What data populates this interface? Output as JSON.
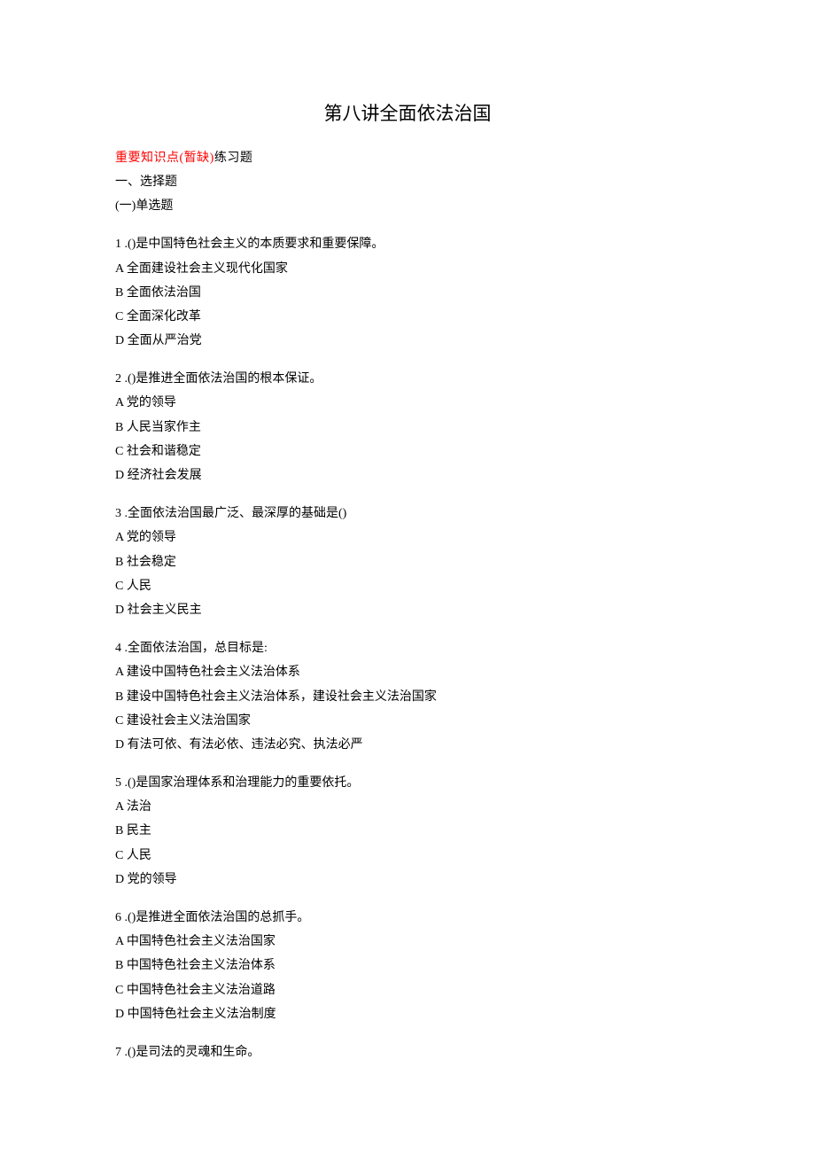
{
  "title": "第八讲全面依法治国",
  "header": {
    "important_points": "重要知识点(暂缺)",
    "exercises": "练习题"
  },
  "section1": "一、选择题",
  "subsection1": "(一)单选题",
  "questions": [
    {
      "num": "1",
      "prefix": " .(",
      "blank": "          ",
      "suffix": ")是中国特色社会主义的本质要求和重要保障。",
      "options": [
        "A 全面建设社会主义现代化国家",
        "B 全面依法治国",
        "C 全面深化改革",
        "D 全面从严治党"
      ]
    },
    {
      "num": "2",
      "prefix": " .(",
      "blank": "          ",
      "suffix": ")是推进全面依法治国的根本保证。",
      "options": [
        "A 党的领导",
        "B 人民当家作主",
        "C 社会和谐稳定",
        "D 经济社会发展"
      ]
    },
    {
      "num": "3",
      "prefix": " .全面依法治国最广泛、最深厚的基础是(",
      "blank": "     ",
      "suffix": ")",
      "options": [
        "A 党的领导",
        "B 社会稳定",
        "C 人民",
        "D 社会主义民主"
      ]
    },
    {
      "num": "4",
      "prefix": " .全面依法治国，总目标是:",
      "blank": "",
      "suffix": "",
      "options": [
        "A 建设中国特色社会主义法治体系",
        "B 建设中国特色社会主义法治体系，建设社会主义法治国家",
        "C 建设社会主义法治国家",
        "D 有法可依、有法必依、违法必究、执法必严"
      ]
    },
    {
      "num": "5",
      "prefix": " .(",
      "blank": "          ",
      "suffix": ")是国家治理体系和治理能力的重要依托。",
      "options": [
        "A 法治",
        "B 民主",
        "C 人民",
        "D 党的领导"
      ]
    },
    {
      "num": "6",
      "prefix": " .(",
      "blank": "     ",
      "suffix": ")是推进全面依法治国的总抓手。",
      "options": [
        "A 中国特色社会主义法治国家",
        "B 中国特色社会主义法治体系",
        "C 中国特色社会主义法治道路",
        "D 中国特色社会主义法治制度"
      ]
    },
    {
      "num": "7",
      "prefix": " .(",
      "blank": "          ",
      "suffix": ")是司法的灵魂和生命。",
      "options": []
    }
  ]
}
